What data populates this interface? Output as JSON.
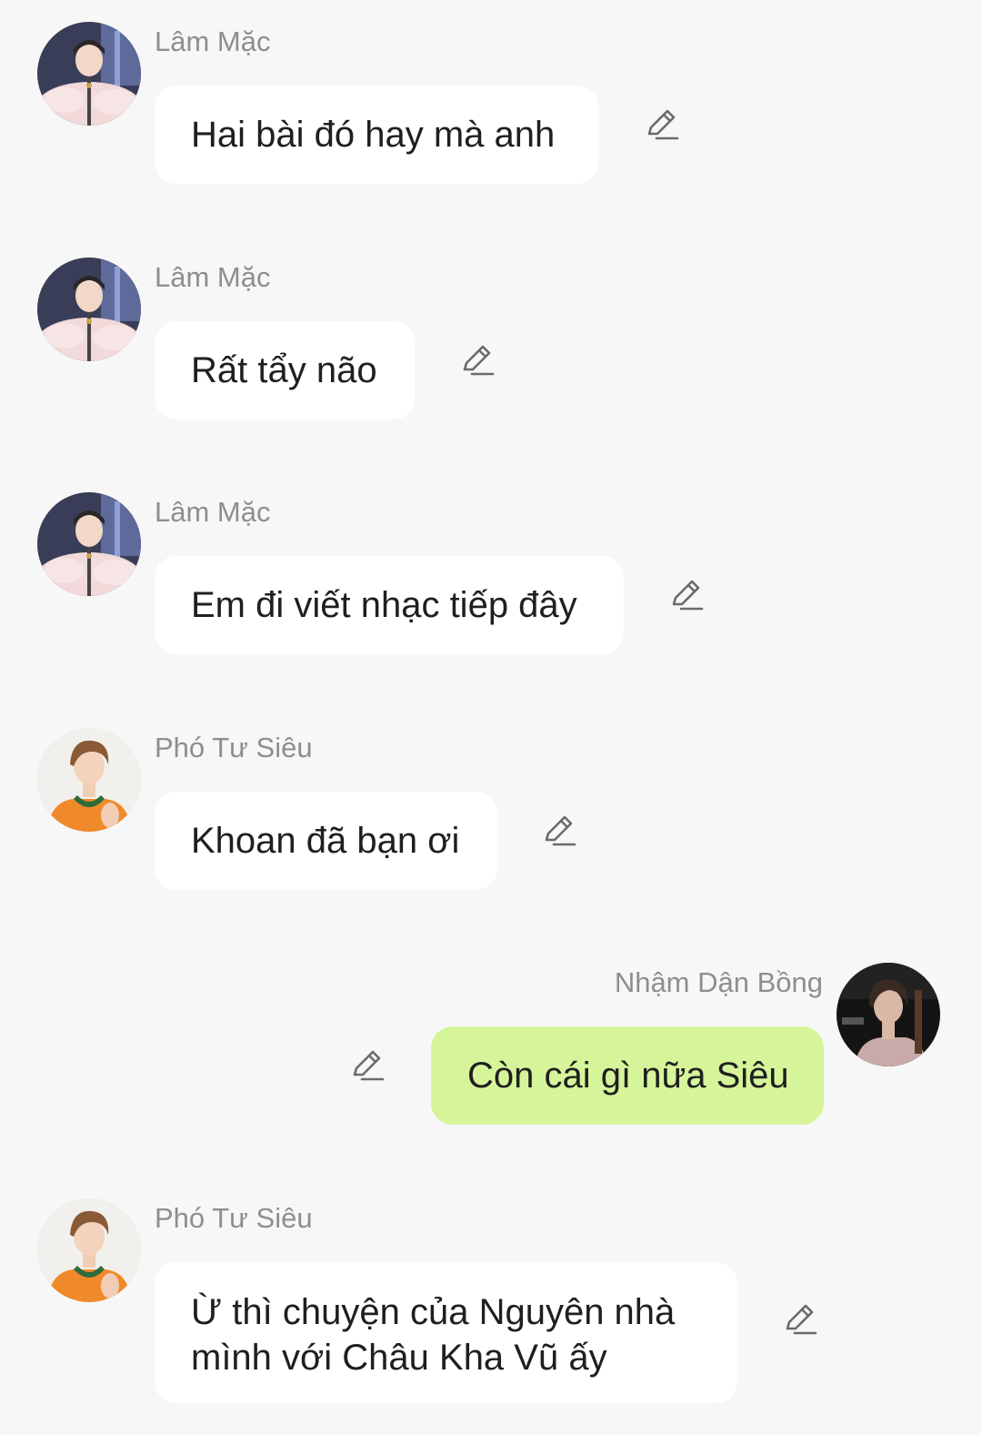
{
  "messages": [
    {
      "sender": "Lâm Mặc",
      "text": "Hai bài đó hay mà anh",
      "avatar": "avatar-lam-mac",
      "side": "left"
    },
    {
      "sender": "Lâm Mặc",
      "text": "Rất tẩy não",
      "avatar": "avatar-lam-mac",
      "side": "left"
    },
    {
      "sender": "Lâm Mặc",
      "text": "Em đi viết nhạc tiếp đây",
      "avatar": "avatar-lam-mac",
      "side": "left"
    },
    {
      "sender": "Phó Tư Siêu",
      "text": "Khoan đã bạn ơi",
      "avatar": "avatar-pho-tu-sieu",
      "side": "left"
    },
    {
      "sender": "Nhậm Dận Bồng",
      "text": "Còn cái gì nữa Siêu",
      "avatar": "avatar-nham-dan-bong",
      "side": "right"
    },
    {
      "sender": "Phó Tư Siêu",
      "text": "Ừ thì chuyện của Nguyên nhà mình với Châu Kha Vũ ấy",
      "avatar": "avatar-pho-tu-sieu",
      "side": "left"
    }
  ],
  "icons": {
    "edit": "pencil-icon"
  },
  "colors": {
    "background": "#f7f7f7",
    "bubble_incoming": "#ffffff",
    "bubble_outgoing": "#d6f59a",
    "sender_name": "#8e8e8e",
    "message_text": "#1f1f1f",
    "icon": "#6b6b6b"
  }
}
